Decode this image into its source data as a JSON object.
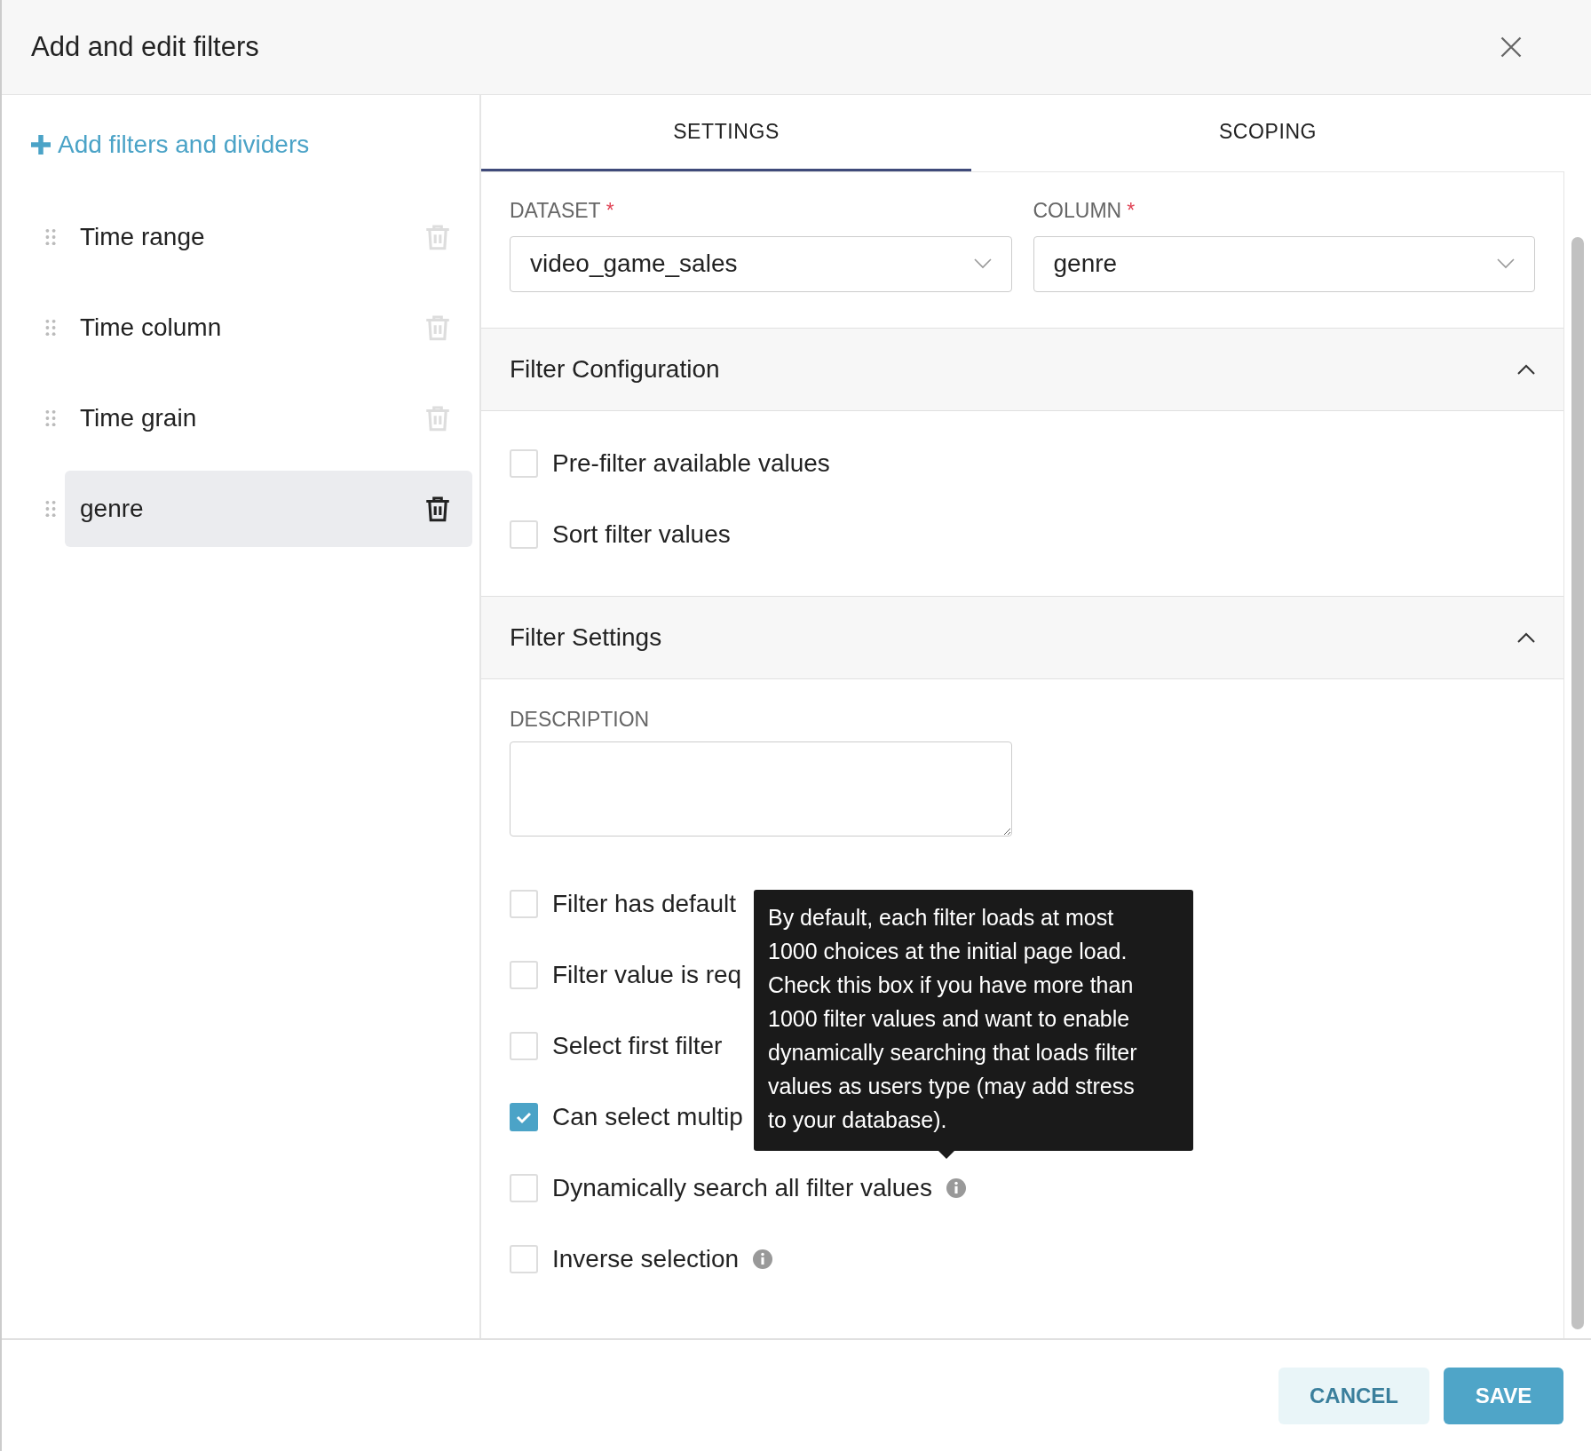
{
  "window": {
    "title": "Add and edit filters"
  },
  "sidebar": {
    "add_link": "Add filters and dividers",
    "items": [
      {
        "label": "Time range",
        "selected": false
      },
      {
        "label": "Time column",
        "selected": false
      },
      {
        "label": "Time grain",
        "selected": false
      },
      {
        "label": "genre",
        "selected": true
      }
    ]
  },
  "tabs": [
    {
      "label": "SETTINGS",
      "selected": true
    },
    {
      "label": "SCOPING",
      "selected": false
    }
  ],
  "fields": [
    {
      "label": "DATASET",
      "required_mark": "*",
      "value": "video_game_sales"
    },
    {
      "label": "COLUMN",
      "required_mark": "*",
      "value": "genre"
    }
  ],
  "sections": [
    {
      "title": "Filter Configuration",
      "expanded": true,
      "options": [
        {
          "label": "Pre-filter available values",
          "checked": false,
          "info": false
        },
        {
          "label": "Sort filter values",
          "checked": false,
          "info": false
        }
      ]
    },
    {
      "title": "Filter Settings",
      "expanded": true,
      "description_label": "DESCRIPTION",
      "options": [
        {
          "label": "Filter has default",
          "checked": false,
          "info": false
        },
        {
          "label": "Filter value is req",
          "checked": false,
          "info": false
        },
        {
          "label": "Select first filter",
          "checked": false,
          "info": false
        },
        {
          "label": "Can select multip",
          "checked": true,
          "info": false
        },
        {
          "label": "Dynamically search all filter values",
          "checked": false,
          "info": true
        },
        {
          "label": "Inverse selection",
          "checked": false,
          "info": true
        }
      ]
    }
  ],
  "tooltip": {
    "text": "By default, each filter loads at most 1000 choices at the initial page load. Check this box if you have more than 1000 filter values and want to enable dynamically searching that loads filter values as users type (may add stress to your database)."
  },
  "buttons": [
    {
      "label": "CANCEL",
      "kind": "secondary"
    },
    {
      "label": "SAVE",
      "kind": "primary"
    }
  ]
}
